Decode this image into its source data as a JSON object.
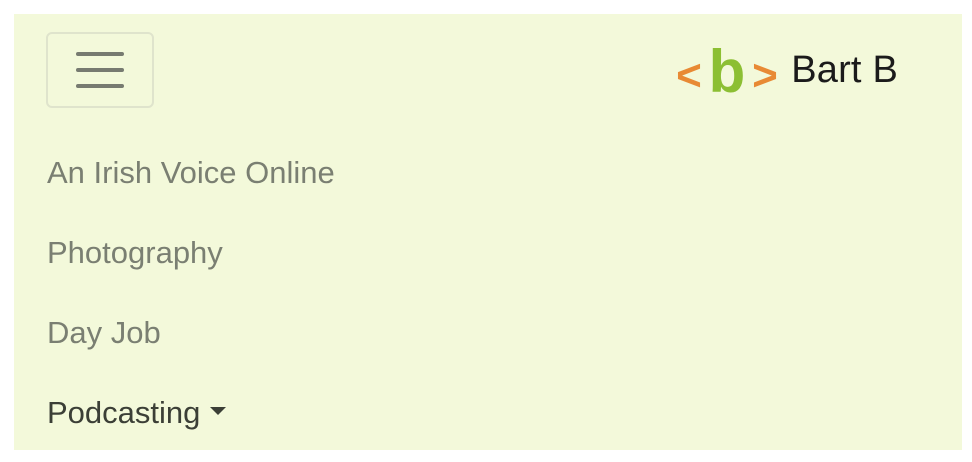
{
  "navbar": {
    "toggler": {
      "icon": "hamburger-menu-icon",
      "icon_color": "#777b70"
    },
    "brand": {
      "logo_text": {
        "left": "<",
        "middle": "b",
        "right": ">"
      },
      "name": "Bart B",
      "logo_colors": {
        "brackets": "#e88a34",
        "letter": "#8cbf33"
      }
    },
    "items": [
      {
        "label": "An Irish Voice Online"
      },
      {
        "label": "Photography"
      },
      {
        "label": "Day Job"
      },
      {
        "label": "Podcasting",
        "has_dropdown": true,
        "icon": "caret-down-icon"
      }
    ]
  },
  "colors": {
    "navbar_bg": "#f3f9da",
    "link_muted": "#7a7f72",
    "link_active": "#3b3f36"
  }
}
